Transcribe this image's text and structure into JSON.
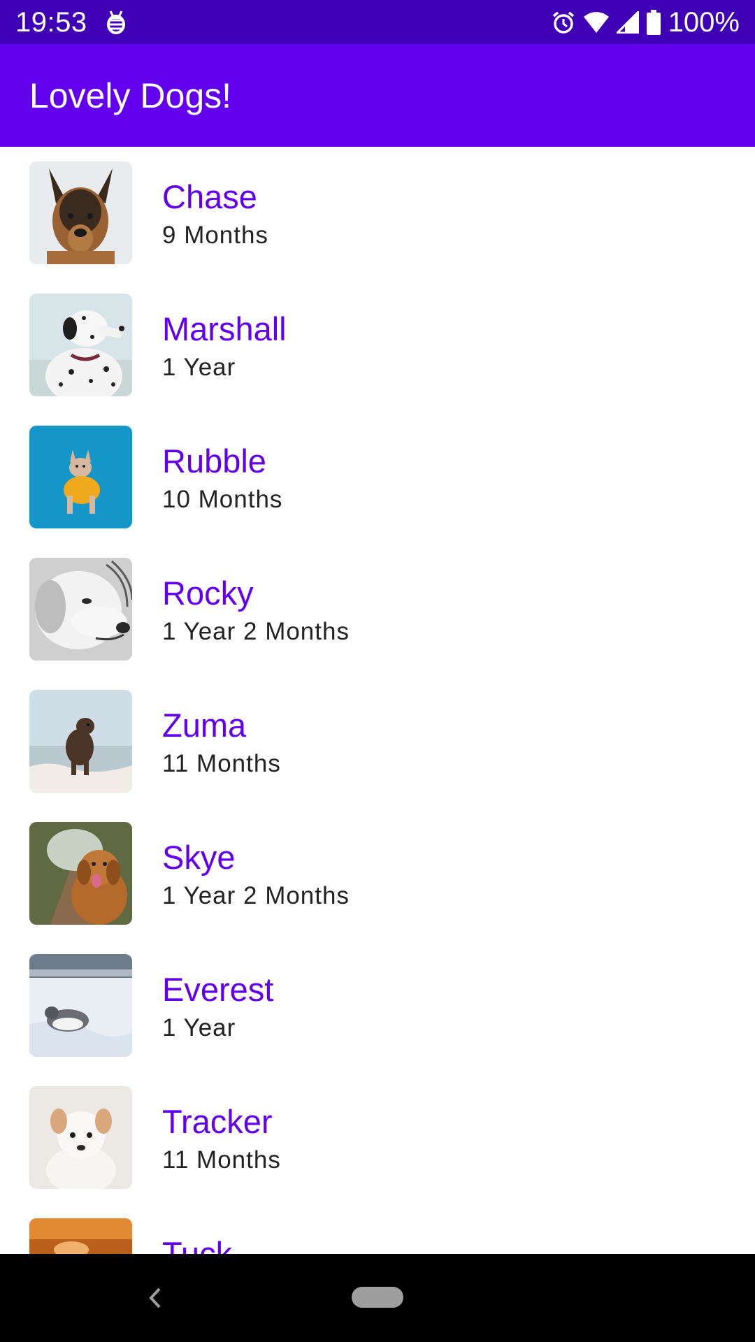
{
  "status_bar": {
    "time": "19:53",
    "battery_percent": "100%",
    "icons": [
      "debug-bug-icon",
      "alarm-icon",
      "wifi-icon",
      "cell-signal-icon",
      "battery-icon"
    ]
  },
  "app_bar": {
    "title": "Lovely Dogs!"
  },
  "dogs": [
    {
      "name": "Chase",
      "age": "9 Months"
    },
    {
      "name": "Marshall",
      "age": "1 Year"
    },
    {
      "name": "Rubble",
      "age": "10 Months"
    },
    {
      "name": "Rocky",
      "age": "1 Year 2 Months"
    },
    {
      "name": "Zuma",
      "age": "11 Months"
    },
    {
      "name": "Skye",
      "age": "1 Year 2 Months"
    },
    {
      "name": "Everest",
      "age": "1 Year"
    },
    {
      "name": "Tracker",
      "age": "11 Months"
    },
    {
      "name": "Tuck",
      "age": ""
    }
  ],
  "nav_bar": {
    "icons": [
      "back-icon",
      "home-pill-icon"
    ]
  },
  "colors": {
    "status_bar": "#3f00b5",
    "app_bar": "#6200ee",
    "name_text": "#6200ee",
    "age_text": "#222222",
    "nav_bar": "#000000"
  }
}
